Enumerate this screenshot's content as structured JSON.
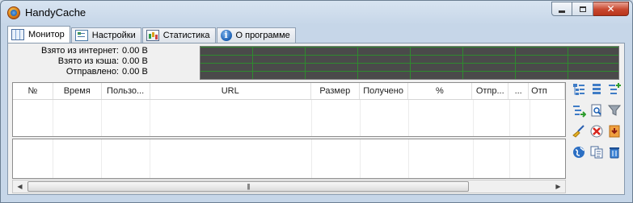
{
  "window": {
    "title": "HandyCache",
    "controls": {
      "minimize": "minimize",
      "maximize": "maximize",
      "close": "close"
    }
  },
  "tabs": [
    {
      "label": "Монитор",
      "icon": "monitor-icon",
      "active": true
    },
    {
      "label": "Настройки",
      "icon": "settings-icon",
      "active": false
    },
    {
      "label": "Статистика",
      "icon": "statistics-icon",
      "active": false
    },
    {
      "label": "О программе",
      "icon": "info-icon",
      "active": false
    }
  ],
  "stats": {
    "from_internet": {
      "label": "Взято из интернет:",
      "value": "0.00 B"
    },
    "from_cache": {
      "label": "Взято из кэша:",
      "value": "0.00 B"
    },
    "sent": {
      "label": "Отправлено:",
      "value": "0.00 B"
    }
  },
  "graph": {
    "background": "#4a4a4a",
    "grid_color": "#2f8a2f"
  },
  "table": {
    "columns": [
      "№",
      "Время",
      "Пользо...",
      "URL",
      "Размер",
      "Получено",
      "%",
      "Отпр...",
      "...",
      "Отп"
    ],
    "rows": []
  },
  "toolbar_icons": [
    "tree-expand-icon",
    "tree-list-icon",
    "tree-add-icon",
    "tree-export-icon",
    "page-search-icon",
    "filter-icon",
    "broom-clear-icon",
    "delete-red-icon",
    "download-orange-icon",
    "globe-icon",
    "copy-icon",
    "trash-icon"
  ]
}
